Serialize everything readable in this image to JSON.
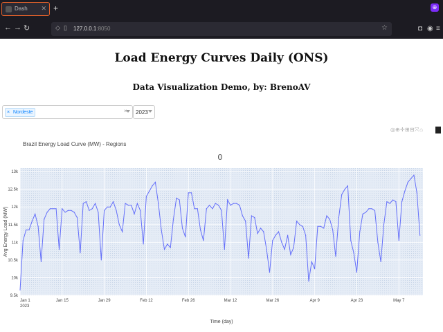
{
  "browser": {
    "tab_title": "Dash",
    "url_host": "127.0.0.1",
    "url_port": ":8050",
    "icons": [
      "back-icon",
      "forward-icon",
      "reload-icon",
      "shield-icon",
      "page-icon",
      "star-icon",
      "pocket-icon",
      "account-icon",
      "menu-icon",
      "close-icon",
      "plus-icon"
    ]
  },
  "page": {
    "title": "Load Energy Curves Daily (ONS)",
    "subtitle": "Data Visualization Demo, by: BrenoAV"
  },
  "filters": {
    "region_selected": "Nordeste",
    "region_clear": "×",
    "year_selected": "2023"
  },
  "modebar": {
    "icons": [
      "camera-icon",
      "zoom-icon",
      "pan-icon",
      "zoom-in-icon",
      "zoom-out-icon",
      "autoscale-icon",
      "reset-icon",
      "plotly-logo-icon"
    ]
  },
  "chart_data": {
    "type": "line",
    "title": "Brazil Energy Load Curve (MW) - Regions",
    "xlabel": "Time (day)",
    "ylabel": "Avg Energy Load (MW)",
    "ylim": [
      9500,
      13100
    ],
    "yticks": [
      9500,
      10000,
      10500,
      11000,
      11500,
      12000,
      12500,
      13000
    ],
    "ytick_labels": [
      "9.5k",
      "10k",
      "10.5k",
      "11k",
      "11.5k",
      "12k",
      "12.5k",
      "13k"
    ],
    "xticks": [
      0,
      14,
      28,
      42,
      56,
      70,
      84,
      98,
      112,
      126
    ],
    "xtick_labels": [
      "Jan 1",
      "Jan 15",
      "Jan 29",
      "Feb 12",
      "Feb 26",
      "Mar 12",
      "Mar 26",
      "Apr 9",
      "Apr 23",
      "May 7"
    ],
    "xtick_sublabel": "2023",
    "xlim": [
      0,
      134
    ],
    "grid": true,
    "line_color": "#636efa",
    "plot_bg": "#e5ecf6",
    "series": [
      {
        "values": [
          9650,
          11050,
          11350,
          11350,
          11600,
          11800,
          11450,
          10450,
          11650,
          11850,
          11950,
          11950,
          11950,
          10800,
          11950,
          11850,
          11900,
          11900,
          11850,
          11700,
          10700,
          12100,
          12150,
          11900,
          11950,
          12100,
          11850,
          10500,
          11900,
          12000,
          12000,
          12150,
          11900,
          11500,
          11300,
          12100,
          12050,
          12050,
          11800,
          12100,
          11900,
          10950,
          12300,
          12450,
          12600,
          12700,
          12100,
          11350,
          10800,
          10950,
          10850,
          11650,
          12250,
          12200,
          11400,
          11150,
          12400,
          12400,
          11950,
          11950,
          11350,
          11050,
          11950,
          12050,
          11950,
          12100,
          12050,
          11900,
          10800,
          12200,
          12050,
          12100,
          12100,
          12050,
          11750,
          11600,
          10550,
          11750,
          11700,
          11250,
          11400,
          11300,
          10800,
          10150,
          11050,
          11200,
          11300,
          11000,
          10800,
          11200,
          10650,
          10850,
          11600,
          11500,
          11450,
          11200,
          9900,
          10450,
          10250,
          11450,
          11450,
          11400,
          11750,
          11650,
          11350,
          10600,
          11700,
          12350,
          12500,
          12600,
          11050,
          10700,
          10150,
          11300,
          11800,
          11850,
          11950,
          11950,
          11900,
          11000,
          10450,
          11500,
          12150,
          12100,
          12200,
          12150,
          11050,
          12150,
          12450,
          12700,
          12800,
          12900,
          12400,
          11200
        ]
      }
    ]
  }
}
